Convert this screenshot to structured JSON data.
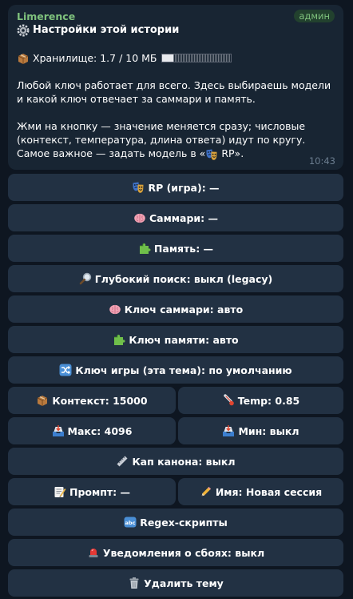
{
  "message": {
    "sender": "Limerence",
    "badge": "админ",
    "title": "Настройки этой истории",
    "storage_label": "Хранилище: 1.7 / 10 МБ",
    "storage_fraction": 0.17,
    "paragraph1": "Любой ключ работает для всего. Здесь выбираешь модели и какой ключ отвечает за саммари и память.",
    "paragraph2_line1": "Жми на кнопку — значение меняется сразу; числовые (контекст, температура, длина ответа) идут по кругу.",
    "paragraph2_line2_a": "Самое важное — задать модель в «",
    "paragraph2_line2_b": " RP».",
    "time": "10:43",
    "title_icon": "gear-icon",
    "storage_icon": "package-icon"
  },
  "buttons": {
    "rp": {
      "label": "RP (игра): —",
      "icon": "theater-masks-icon"
    },
    "summary": {
      "label": "Саммари: —",
      "icon": "brain-icon"
    },
    "memory": {
      "label": "Память: —",
      "icon": "puzzle-icon"
    },
    "deep_search": {
      "label": "Глубокий поиск: выкл (legacy)",
      "icon": "magnifier-icon"
    },
    "summary_key": {
      "label": "Ключ саммари: авто",
      "icon": "brain-icon"
    },
    "memory_key": {
      "label": "Ключ памяти: авто",
      "icon": "puzzle-icon"
    },
    "game_key": {
      "label": "Ключ игры (эта тема): по умолчанию",
      "icon": "shuffle-icon"
    },
    "context": {
      "label": "Контекст: 15000",
      "icon": "package-icon"
    },
    "temp": {
      "label": "Temp: 0.85",
      "icon": "thermometer-icon"
    },
    "max": {
      "label": "Макс: 4096",
      "icon": "inbox-tray-icon"
    },
    "min": {
      "label": "Мин: выкл",
      "icon": "inbox-tray-icon"
    },
    "canon_cap": {
      "label": "Кап канона: выкл",
      "icon": "ruler-icon"
    },
    "prompt": {
      "label": "Промпт: —",
      "icon": "memo-icon"
    },
    "name": {
      "label": "Имя: Новая сессия",
      "icon": "pencil-icon"
    },
    "regex": {
      "label": "Regex-скрипты",
      "icon": "abc-icon"
    },
    "failure_notify": {
      "label": "Уведомления о сбоях: выкл",
      "icon": "siren-icon"
    },
    "delete": {
      "label": "Удалить тему",
      "icon": "trash-icon"
    }
  }
}
